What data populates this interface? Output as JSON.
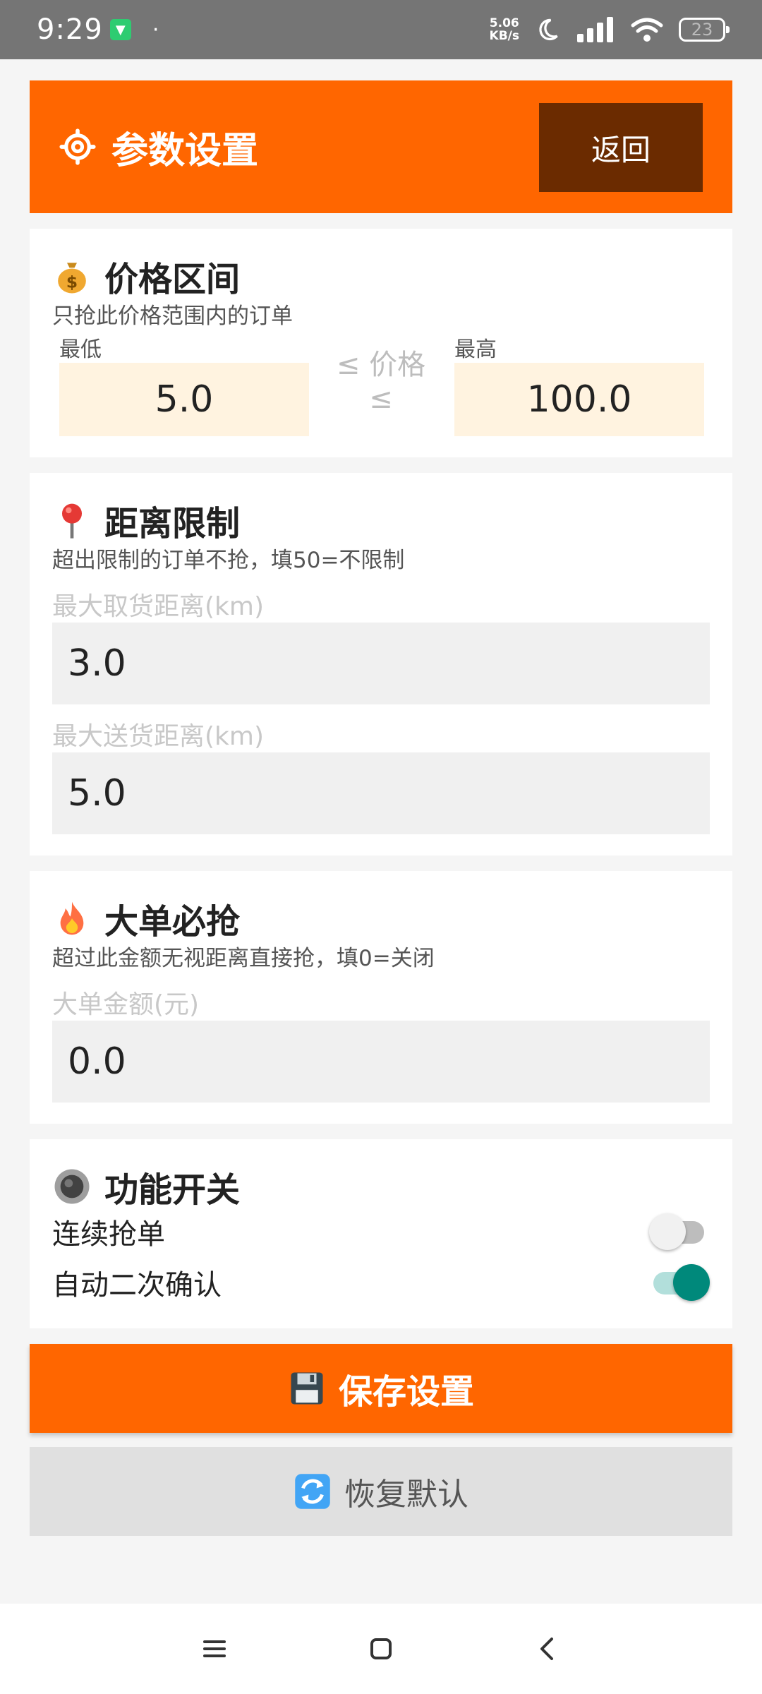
{
  "status_bar": {
    "time": "9:29",
    "dot": "·",
    "speed_top": "5.06",
    "speed_bottom": "KB/s",
    "battery": "23"
  },
  "header": {
    "title": "参数设置",
    "back_label": "返回"
  },
  "price_section": {
    "title": "价格区间",
    "subtitle": "只抢此价格范围内的订单",
    "min_label": "最低",
    "max_label": "最高",
    "middle_text": "≤ 价格 ≤",
    "min_value": "5.0",
    "max_value": "100.0"
  },
  "distance_section": {
    "title": "距离限制",
    "subtitle": "超出限制的订单不抢，填50=不限制",
    "pickup_label": "最大取货距离(km)",
    "pickup_value": "3.0",
    "delivery_label": "最大送货距离(km)",
    "delivery_value": "5.0"
  },
  "bigorder_section": {
    "title": "大单必抢",
    "subtitle": "超过此金额无视距离直接抢，填0=关闭",
    "amount_label": "大单金额(元)",
    "amount_value": "0.0"
  },
  "switch_section": {
    "title": "功能开关",
    "continuous_label": "连续抢单",
    "continuous_on": false,
    "auto_confirm_label": "自动二次确认",
    "auto_confirm_on": true
  },
  "buttons": {
    "save_label": "保存设置",
    "reset_label": "恢复默认"
  },
  "colors": {
    "accent": "#ff6600",
    "back_button": "#6b2b00",
    "switch_on": "#00897b",
    "price_input_bg": "#fff3e0"
  }
}
